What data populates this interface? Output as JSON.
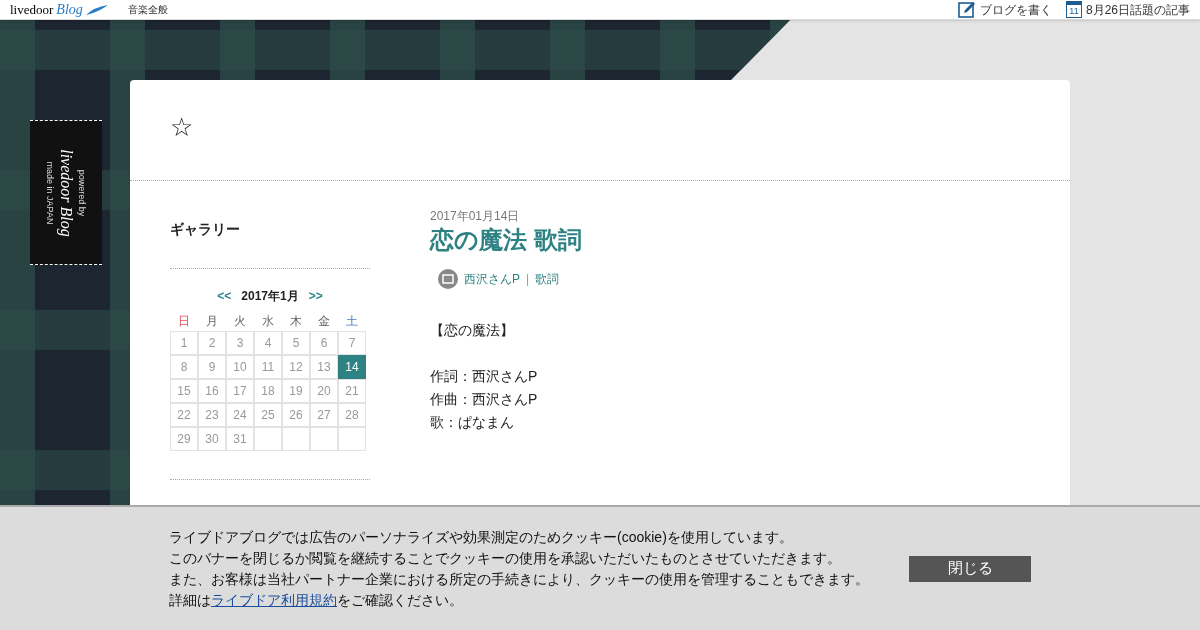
{
  "topbar": {
    "logo": {
      "brand": "livedoor",
      "product": "Blog"
    },
    "category": "音楽全般",
    "links": [
      {
        "kind": "write",
        "label": "ブログを書く"
      },
      {
        "kind": "calendar",
        "icon_day": "11",
        "label": "8月26日話題の記事"
      }
    ]
  },
  "badge": {
    "lines": [
      "powered by",
      "livedoor Blog",
      "made in JAPAN"
    ]
  },
  "blog": {
    "title": "☆"
  },
  "sidebar": {
    "gallery_title": "ギャラリー",
    "calendar": {
      "prev": "<<",
      "month": "2017年1月",
      "next": ">>",
      "weekdays": [
        {
          "label": "日",
          "kind": "sunday"
        },
        {
          "label": "月",
          "kind": "weekday"
        },
        {
          "label": "火",
          "kind": "weekday"
        },
        {
          "label": "水",
          "kind": "weekday"
        },
        {
          "label": "木",
          "kind": "weekday"
        },
        {
          "label": "金",
          "kind": "weekday"
        },
        {
          "label": "土",
          "kind": "saturday"
        }
      ],
      "days": [
        {
          "day": "1",
          "selected": false
        },
        {
          "day": "2",
          "selected": false
        },
        {
          "day": "3",
          "selected": false
        },
        {
          "day": "4",
          "selected": false
        },
        {
          "day": "5",
          "selected": false
        },
        {
          "day": "6",
          "selected": false
        },
        {
          "day": "7",
          "selected": false
        },
        {
          "day": "8",
          "selected": false
        },
        {
          "day": "9",
          "selected": false
        },
        {
          "day": "10",
          "selected": false
        },
        {
          "day": "11",
          "selected": false
        },
        {
          "day": "12",
          "selected": false
        },
        {
          "day": "13",
          "selected": false
        },
        {
          "day": "14",
          "selected": true
        },
        {
          "day": "15",
          "selected": false
        },
        {
          "day": "16",
          "selected": false
        },
        {
          "day": "17",
          "selected": false
        },
        {
          "day": "18",
          "selected": false
        },
        {
          "day": "19",
          "selected": false
        },
        {
          "day": "20",
          "selected": false
        },
        {
          "day": "21",
          "selected": false
        },
        {
          "day": "22",
          "selected": false
        },
        {
          "day": "23",
          "selected": false
        },
        {
          "day": "24",
          "selected": false
        },
        {
          "day": "25",
          "selected": false
        },
        {
          "day": "26",
          "selected": false
        },
        {
          "day": "27",
          "selected": false
        },
        {
          "day": "28",
          "selected": false
        },
        {
          "day": "29",
          "selected": false
        },
        {
          "day": "30",
          "selected": false
        },
        {
          "day": "31",
          "selected": false
        }
      ]
    }
  },
  "article": {
    "date": "2017年01月14日",
    "title": "恋の魔法 歌詞",
    "categories": [
      "西沢さんP",
      "歌詞"
    ],
    "separator": "|",
    "blocks": [
      [
        "【恋の魔法】"
      ],
      [
        "作詞：西沢さんP",
        "作曲：西沢さんP",
        "歌：ぱなまん"
      ]
    ]
  },
  "cookie_banner": {
    "lines": [
      "ライブドアブログでは広告のパーソナライズや効果測定のためクッキー(cookie)を使用しています。",
      "このバナーを閉じるか閲覧を継続することでクッキーの使用を承認いただいたものとさせていただきます。",
      "また、お客様は当社パートナー企業における所定の手続きにより、クッキーの使用を管理することもできます。"
    ],
    "last_line": {
      "before": "詳細は",
      "link": "ライブドア利用規約",
      "after": "をご確認ください。"
    },
    "close_button": "閉じる"
  }
}
